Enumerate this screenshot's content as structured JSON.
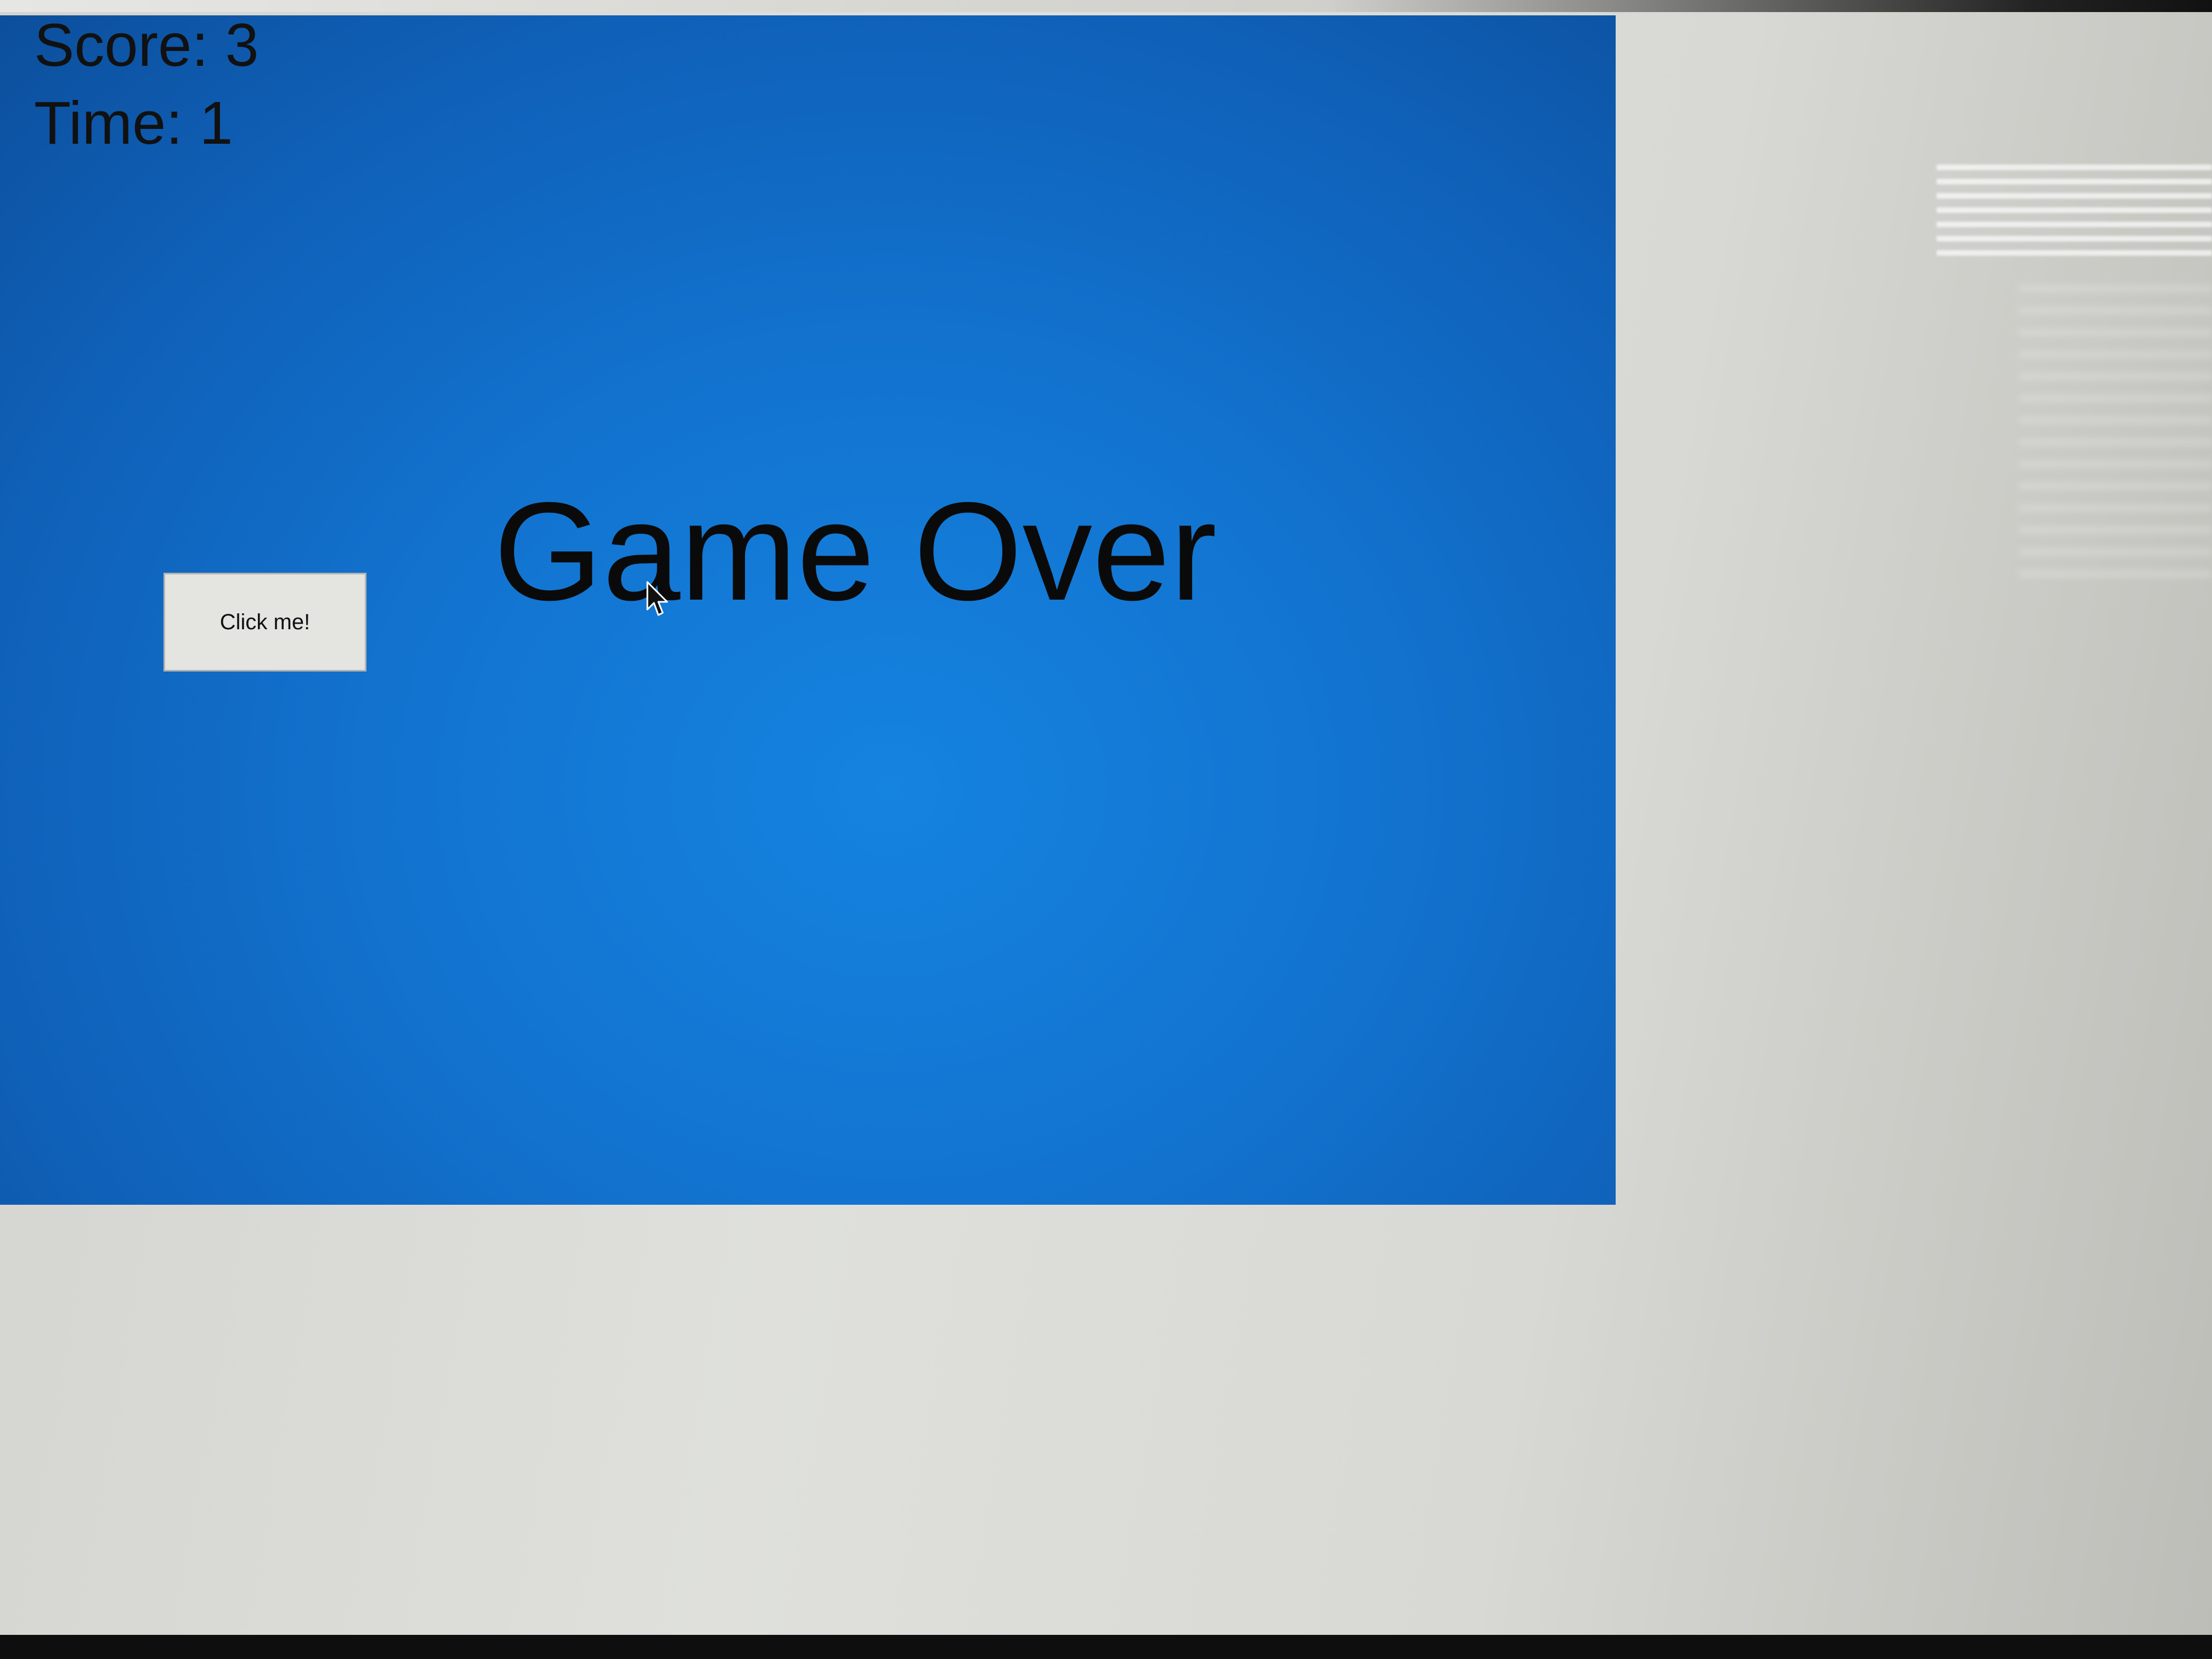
{
  "game": {
    "score_text": "Score: 3",
    "time_text": "Time: 1",
    "status_text": "Game Over",
    "button_label": "Click me!"
  },
  "colors": {
    "game_background": "#1273cf",
    "button_background": "#e4e4e1",
    "text": "#111111"
  },
  "icons": {
    "cursor": "mouse-pointer-icon"
  }
}
